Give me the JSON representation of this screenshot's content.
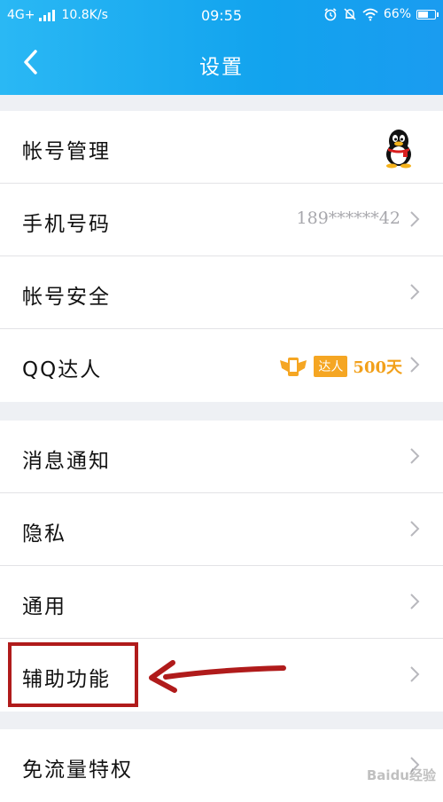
{
  "status_bar": {
    "network": "4G+",
    "speed": "10.8K/s",
    "time": "09:55",
    "battery": "66%",
    "battery_level": 0.66
  },
  "header": {
    "title": "设置"
  },
  "groups": [
    {
      "items": [
        {
          "label": "帐号管理",
          "accessory": "avatar"
        },
        {
          "label": "手机号码",
          "value": "189******42"
        },
        {
          "label": "帐号安全"
        },
        {
          "label": "QQ达人",
          "badge_text": "达人",
          "badge_days": "500天"
        }
      ]
    },
    {
      "items": [
        {
          "label": "消息通知"
        },
        {
          "label": "隐私"
        },
        {
          "label": "通用"
        },
        {
          "label": "辅助功能"
        }
      ]
    },
    {
      "items": [
        {
          "label": "免流量特权"
        }
      ]
    }
  ],
  "annotation": {
    "highlight_color": "#b01b1b"
  },
  "watermark": "Baidu经验",
  "colors": {
    "header_start": "#2ab8f4",
    "header_end": "#1a9cf0",
    "badge": "#f5a623"
  }
}
